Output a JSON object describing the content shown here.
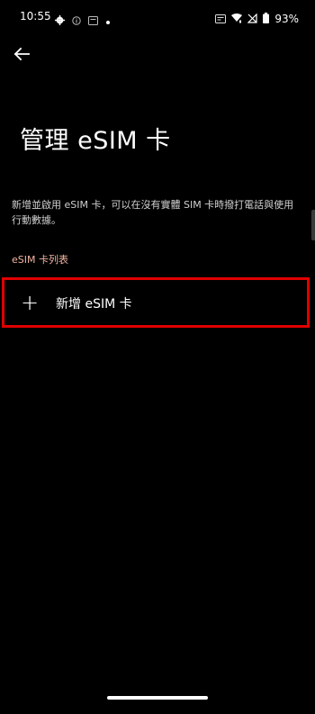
{
  "status_bar": {
    "time": "10:55",
    "battery": "93%",
    "icons": [
      "gear-icon",
      "info-icon",
      "sim-icon",
      "dot-icon",
      "cast-icon",
      "wifi-icon",
      "no-signal-icon",
      "battery-icon"
    ]
  },
  "header": {
    "back_icon": "arrow-left-icon",
    "title": "管理 eSIM 卡"
  },
  "main": {
    "description": "新增並啟用 eSIM 卡，可以在沒有實體 SIM 卡時撥打電話與使用行動數據。",
    "section_label": "eSIM 卡列表",
    "add_item": {
      "icon": "+",
      "label": "新增 eSIM 卡"
    }
  },
  "colors": {
    "background": "#000000",
    "section_label": "#f2b5a2",
    "highlight_border": "#e00000"
  }
}
